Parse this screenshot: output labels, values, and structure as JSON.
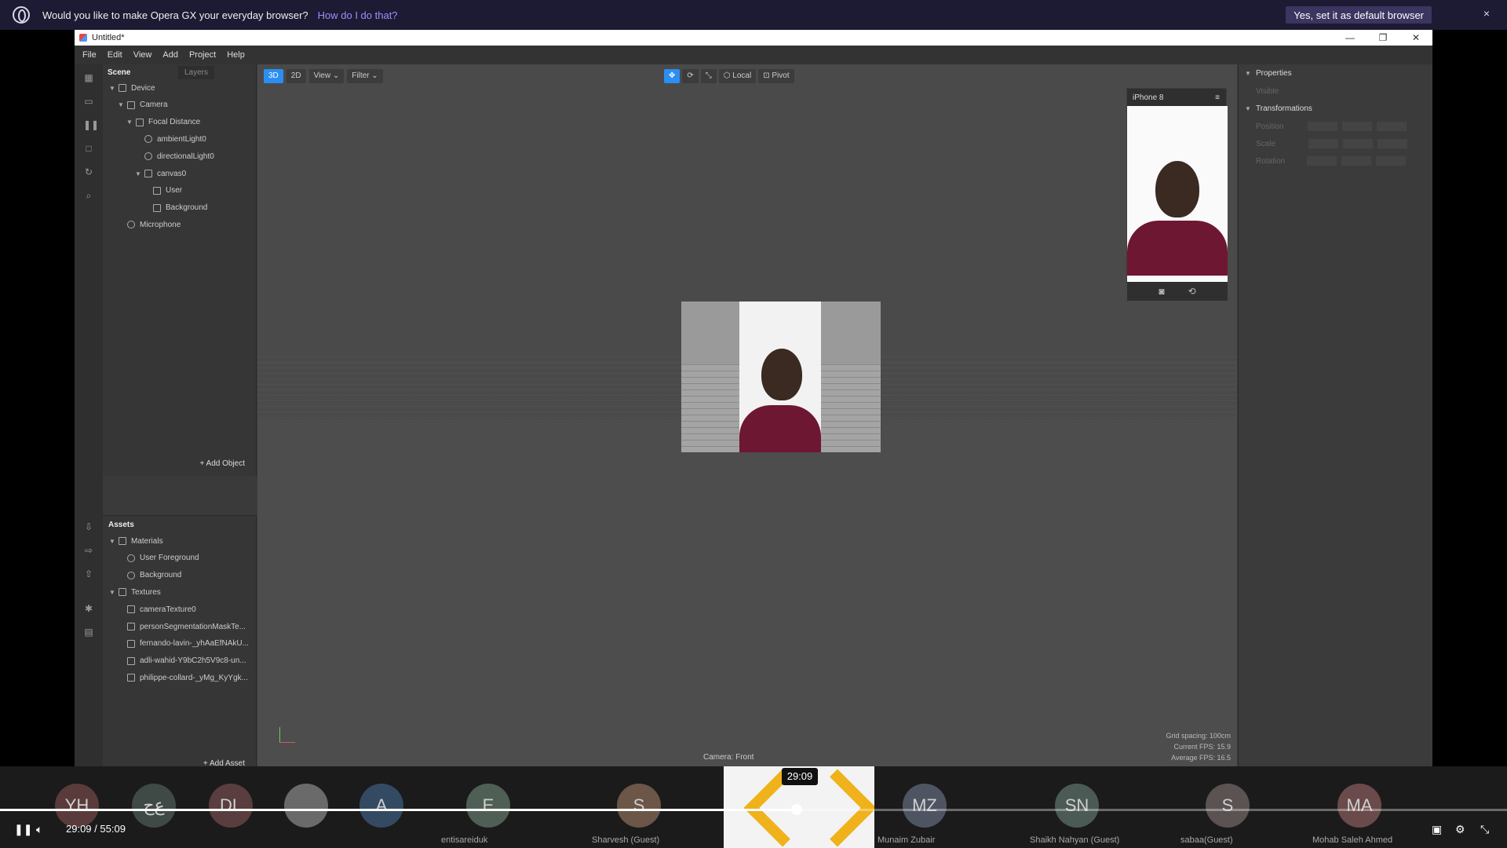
{
  "opera": {
    "message": "Would you like to make Opera GX your everyday browser?",
    "link": "How do I do that?",
    "set_default": "Yes, set it as default browser",
    "close": "×"
  },
  "window": {
    "title": "Untitled*",
    "menu": [
      "File",
      "Edit",
      "View",
      "Add",
      "Project",
      "Help"
    ]
  },
  "scene": {
    "tab_scene": "Scene",
    "tab_layers": "Layers",
    "tree": [
      {
        "label": "Device",
        "depth": 0,
        "expanded": true,
        "icon": "device-icon"
      },
      {
        "label": "Camera",
        "depth": 1,
        "expanded": true,
        "icon": "camera-icon"
      },
      {
        "label": "Focal Distance",
        "depth": 2,
        "expanded": true,
        "icon": "plane-icon"
      },
      {
        "label": "ambientLight0",
        "depth": 3,
        "expanded": null,
        "icon": "ambient-light-icon"
      },
      {
        "label": "directionalLight0",
        "depth": 3,
        "expanded": null,
        "icon": "directional-light-icon"
      },
      {
        "label": "canvas0",
        "depth": 3,
        "expanded": true,
        "icon": "canvas-icon"
      },
      {
        "label": "User",
        "depth": 4,
        "expanded": null,
        "icon": "rectangle-icon"
      },
      {
        "label": "Background",
        "depth": 4,
        "expanded": null,
        "icon": "rectangle-icon"
      },
      {
        "label": "Microphone",
        "depth": 1,
        "expanded": null,
        "icon": "microphone-icon"
      }
    ],
    "add_object": "+ Add Object"
  },
  "assets": {
    "title": "Assets",
    "tree": [
      {
        "label": "Materials",
        "depth": 0,
        "expanded": true,
        "icon": "folder-icon"
      },
      {
        "label": "User Foreground",
        "depth": 1,
        "expanded": null,
        "icon": "material-icon"
      },
      {
        "label": "Background",
        "depth": 1,
        "expanded": null,
        "icon": "material-icon"
      },
      {
        "label": "Textures",
        "depth": 0,
        "expanded": true,
        "icon": "folder-icon"
      },
      {
        "label": "cameraTexture0",
        "depth": 1,
        "expanded": null,
        "icon": "texture-icon"
      },
      {
        "label": "personSegmentationMaskTe...",
        "depth": 1,
        "expanded": null,
        "icon": "texture-icon"
      },
      {
        "label": "fernando-lavin-_yhAaEfNAkU...",
        "depth": 1,
        "expanded": null,
        "icon": "image-icon"
      },
      {
        "label": "adli-wahid-Y9bC2h5V9c8-un...",
        "depth": 1,
        "expanded": null,
        "icon": "image-icon"
      },
      {
        "label": "philippe-collard-_yMg_KyYgk...",
        "depth": 1,
        "expanded": null,
        "icon": "image-icon"
      }
    ],
    "add_asset": "+ Add Asset"
  },
  "viewport": {
    "mode_3d": "3D",
    "mode_2d": "2D",
    "view": "View",
    "filter": "Filter",
    "local": "Local",
    "pivot": "Pivot",
    "camera_label": "Camera: Front",
    "grid_spacing": "Grid spacing: 100cm",
    "current_fps": "Current FPS: 15.9",
    "average_fps": "Average FPS: 16.5"
  },
  "simulator": {
    "device": "iPhone 8"
  },
  "properties": {
    "title": "Properties",
    "visible": "Visible",
    "transformations": "Transformations",
    "position": "Position",
    "scale": "Scale",
    "rotation": "Rotation"
  },
  "meeting": {
    "participants": [
      {
        "initials": "YH",
        "name": "",
        "color": "#5a3b3b"
      },
      {
        "initials": "ﻉﺝ",
        "name": "",
        "color": "#3f4a47"
      },
      {
        "initials": "DL",
        "name": "",
        "color": "#5a3d3f"
      },
      {
        "initials": "",
        "name": "",
        "color": "#6a6a6a"
      },
      {
        "initials": "A",
        "name": "",
        "color": "#344a63"
      },
      {
        "initials": "E",
        "name": "entisareiduk",
        "color": "#4f5f55"
      },
      {
        "initials": "S",
        "name": "Sharvesh (Guest)",
        "color": "#6b5648"
      },
      {
        "initials": "MZ",
        "name": "Munaim Zubair",
        "color": "#4e5462"
      },
      {
        "initials": "SN",
        "name": "Shaikh Nahyan (Guest)",
        "color": "#4b5a55"
      },
      {
        "initials": "S",
        "name": "sabaa(Guest)",
        "color": "#5b5252"
      },
      {
        "initials": "MA",
        "name": "Mohab   Saleh Ahmed",
        "color": "#6a4a4a"
      }
    ]
  },
  "player": {
    "current_time": "29:09",
    "separator": "/",
    "total_time": "55:09",
    "tooltip": "29:09",
    "progress_fraction": 0.5286
  },
  "colors": {
    "accent": "#2b8ef5",
    "opera_bar": "#1d1a33",
    "opera_link": "#a08cff"
  }
}
